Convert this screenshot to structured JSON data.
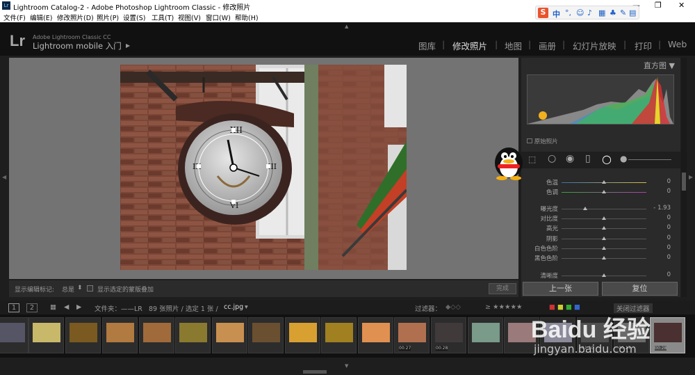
{
  "window": {
    "title": "Lightroom Catalog-2 - Adobe Photoshop Lightroom Classic - 修改照片"
  },
  "menu": [
    "文件(F)",
    "编辑(E)",
    "修改照片(D)",
    "照片(P)",
    "设置(S)",
    "工具(T)",
    "视图(V)",
    "窗口(W)",
    "帮助(H)"
  ],
  "ime": {
    "label": "中"
  },
  "identity": {
    "logo": "Lr",
    "product": "Adobe Lightroom Classic CC",
    "mobile": "Lightroom mobile 入门"
  },
  "modules": [
    "图库",
    "修改照片",
    "地图",
    "画册",
    "幻灯片放映",
    "打印",
    "Web"
  ],
  "active_module": "修改照片",
  "editbar": {
    "label": "显示编辑标记:",
    "value": "总是",
    "overlay": "显示选定的蒙版叠加",
    "done": "完成"
  },
  "panel": {
    "histogram_title": "直方图",
    "original": "原始照片"
  },
  "sliders": [
    {
      "label": "色温",
      "value": "0",
      "pos": 0.5
    },
    {
      "label": "色调",
      "value": "0",
      "pos": 0.5
    },
    {
      "label": "曝光度",
      "value": "- 1.93",
      "pos": 0.28
    },
    {
      "label": "对比度",
      "value": "0",
      "pos": 0.5
    },
    {
      "label": "高光",
      "value": "0",
      "pos": 0.5
    },
    {
      "label": "阴影",
      "value": "0",
      "pos": 0.5
    },
    {
      "label": "白色色阶",
      "value": "0",
      "pos": 0.5
    },
    {
      "label": "黑色色阶",
      "value": "0",
      "pos": 0.5
    },
    {
      "label": "清晰度",
      "value": "0",
      "pos": 0.5
    }
  ],
  "buttons": {
    "prev": "上一张",
    "reset": "复位"
  },
  "filmnav": {
    "view1": "1",
    "view2": "2",
    "folder": "文件夹：——LR",
    "count": "89 张照片 / 选定 1 张 /",
    "file": "cc.jpg",
    "filter_label": "过滤器：",
    "filter_off": "关闭过滤器"
  },
  "thumb_stamps": [
    "00:27",
    "00:28",
    "01:20",
    "00:27",
    "00:28"
  ],
  "watermark": {
    "text": "Baidu 经验",
    "url": "jingyan.baidu.com"
  },
  "colors": {
    "accent": "#d97a2b",
    "panel_bg": "#2a2a2a",
    "center_bg": "#737373"
  }
}
